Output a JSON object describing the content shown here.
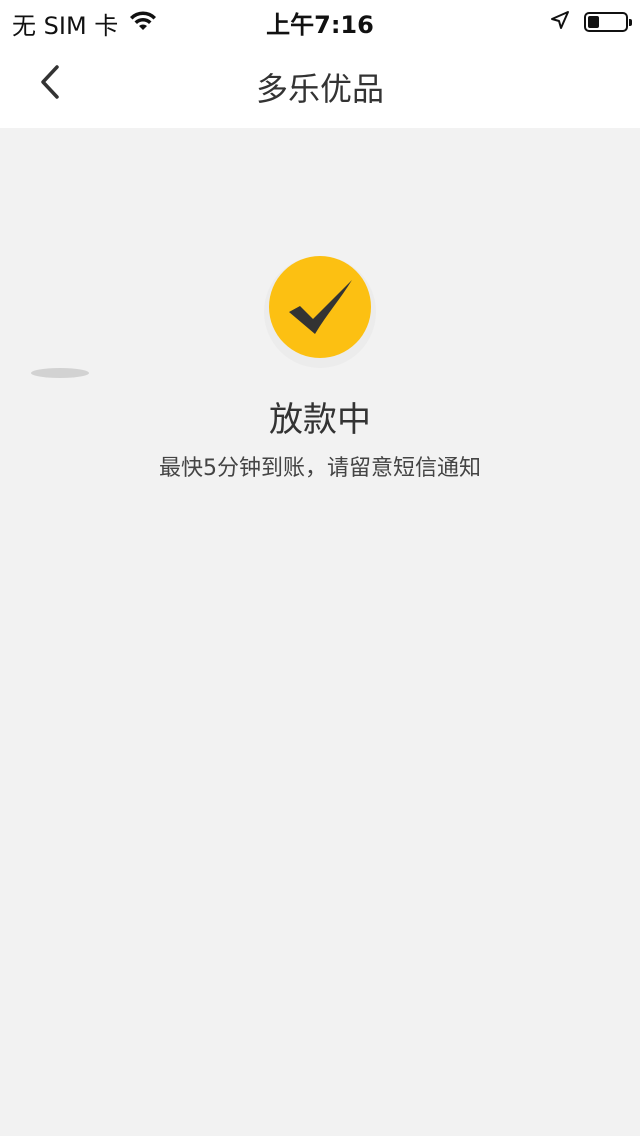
{
  "status_bar": {
    "carrier": "无 SIM 卡",
    "time": "上午7:16",
    "battery_level": 0.3
  },
  "nav": {
    "title": "多乐优品"
  },
  "result": {
    "title": "放款中",
    "description": "最快5分钟到账，请留意短信通知"
  },
  "colors": {
    "accent": "#fcc012",
    "check_mark": "#333333",
    "background": "#f2f2f2"
  }
}
